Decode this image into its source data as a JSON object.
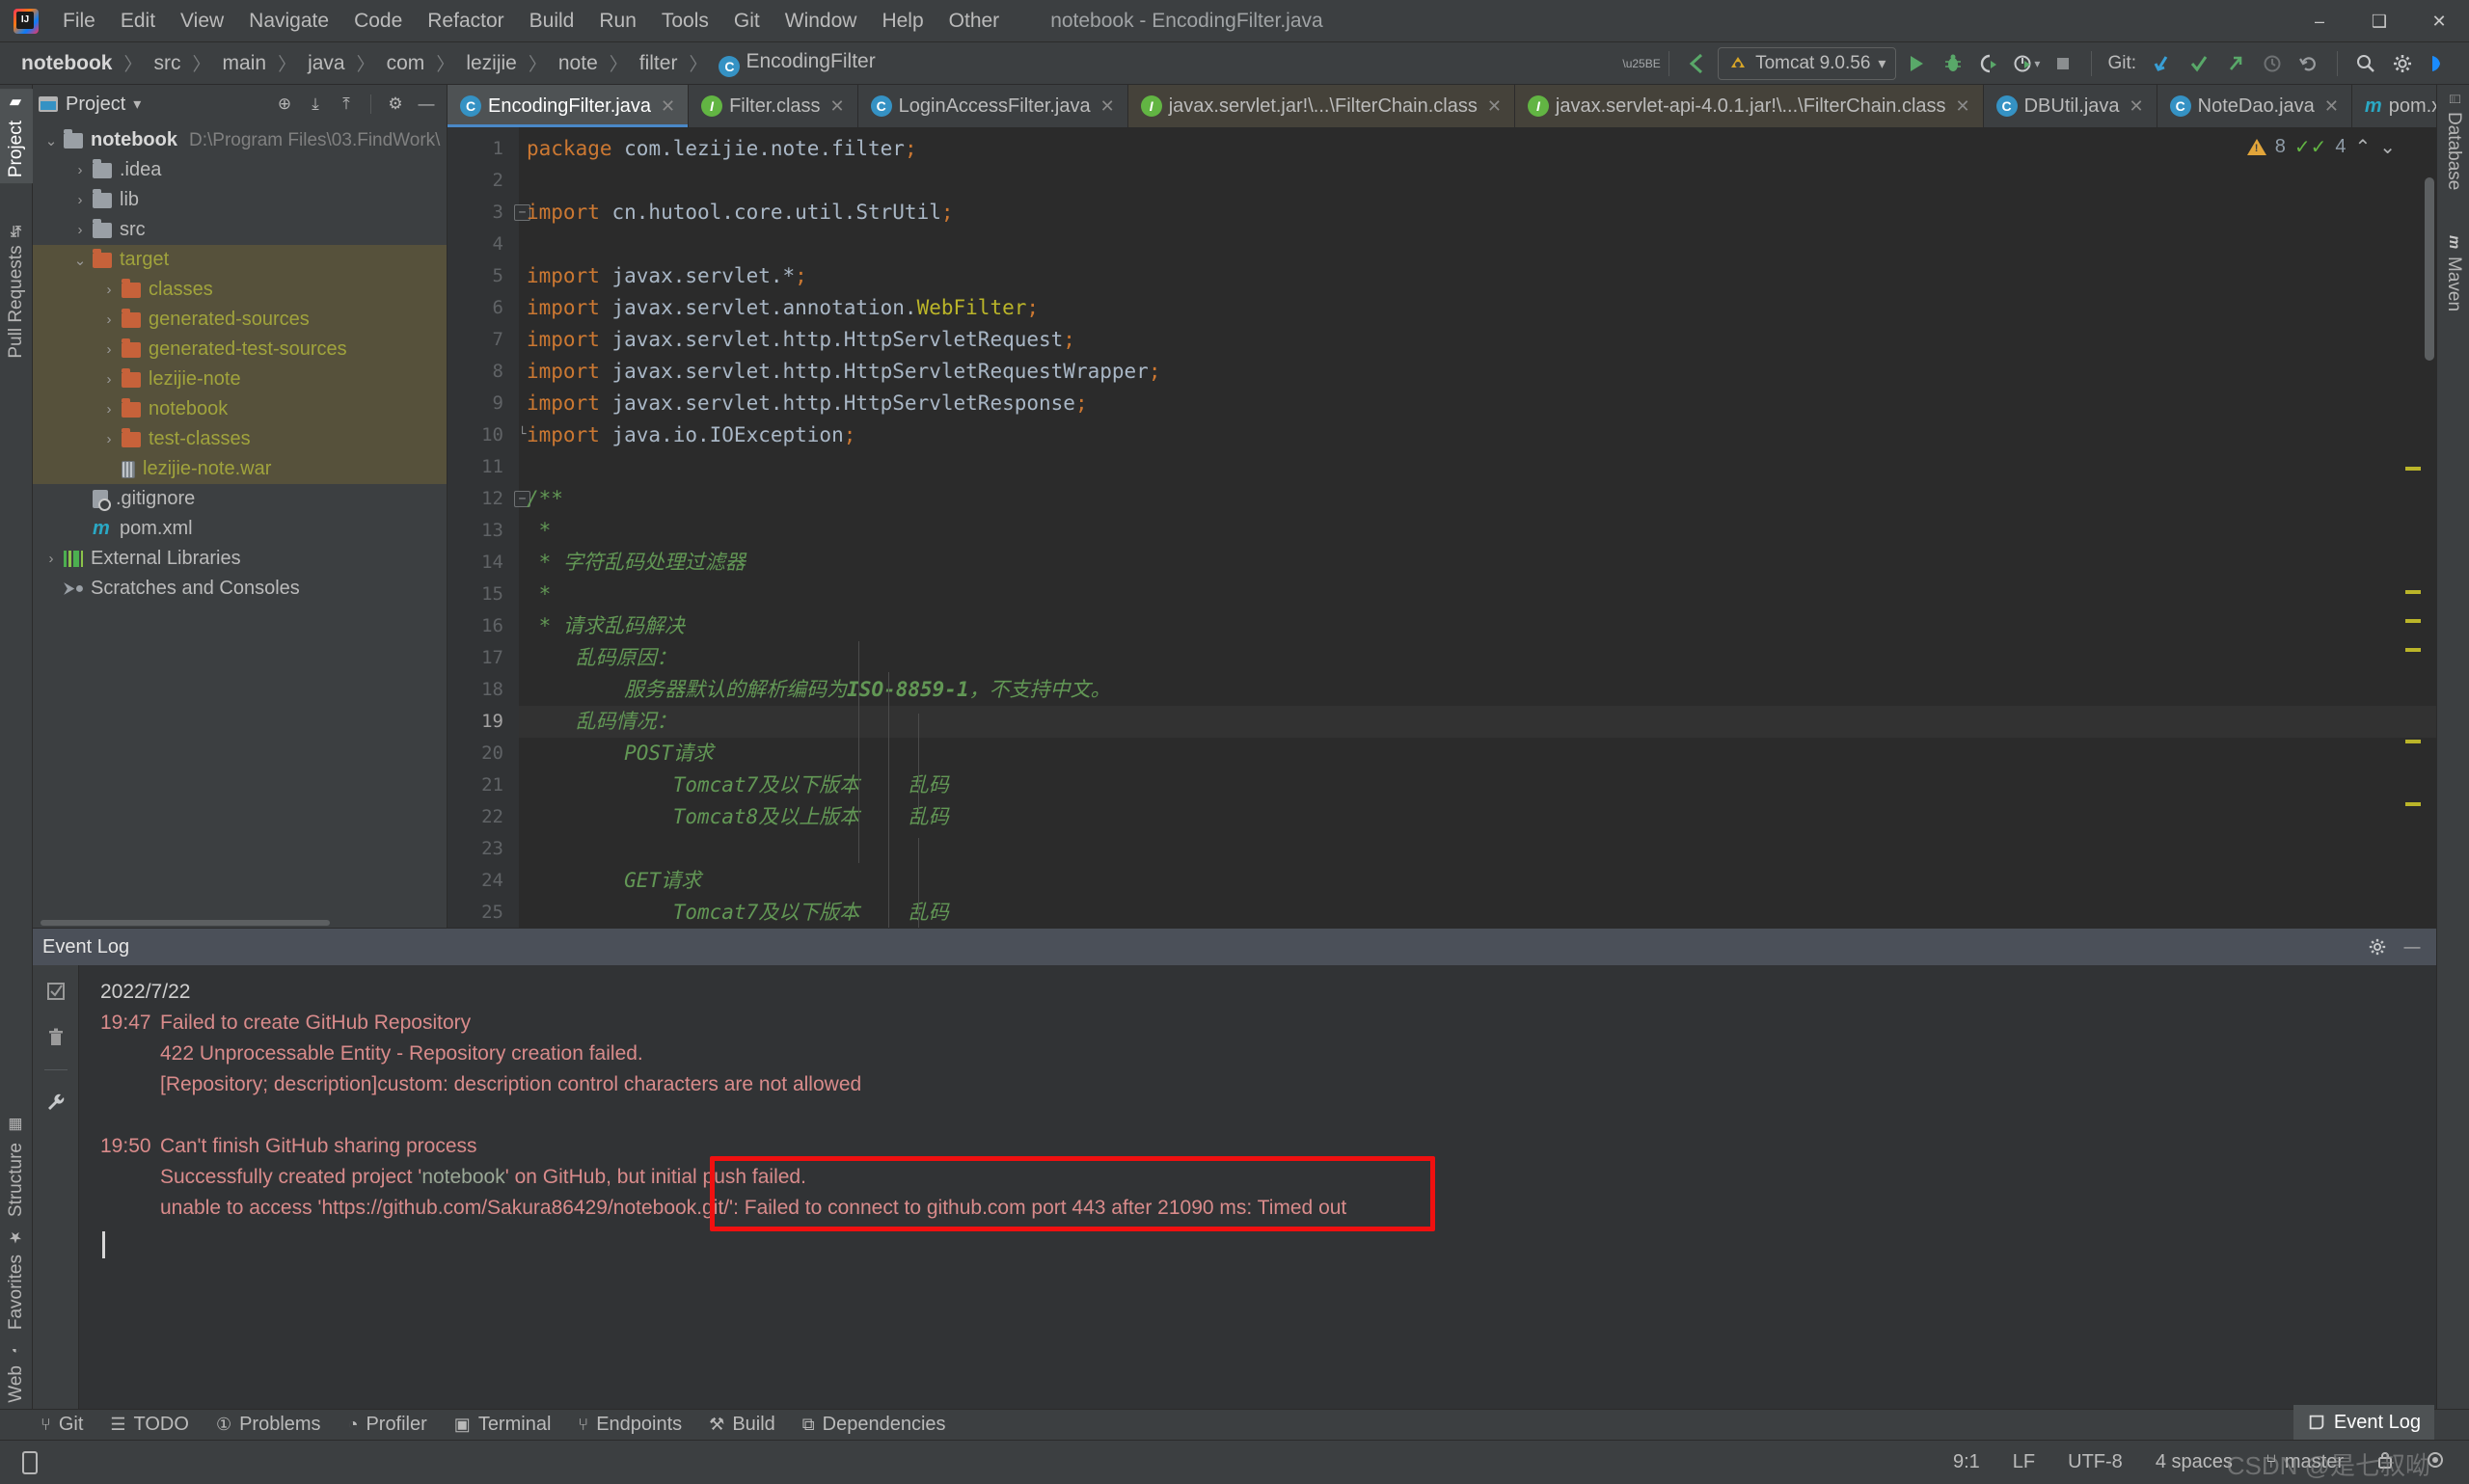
{
  "window": {
    "title": "notebook - EncodingFilter.java",
    "minimize": "–",
    "maximize": "❑",
    "close": "✕"
  },
  "menu": {
    "items": [
      {
        "label": "File"
      },
      {
        "label": "Edit"
      },
      {
        "label": "View"
      },
      {
        "label": "Navigate"
      },
      {
        "label": "Code"
      },
      {
        "label": "Refactor"
      },
      {
        "label": "Build"
      },
      {
        "label": "Run"
      },
      {
        "label": "Tools"
      },
      {
        "label": "Git"
      },
      {
        "label": "Window"
      },
      {
        "label": "Help"
      },
      {
        "label": "Other"
      }
    ]
  },
  "breadcrumb": {
    "items": [
      "notebook",
      "src",
      "main",
      "java",
      "com",
      "lezijie",
      "note",
      "filter"
    ],
    "current_class": "EncodingFilter",
    "class_icon": "C",
    "separator": "〉"
  },
  "toolbar": {
    "user_icon": "user-icon",
    "vcs_update_icon": "update-project-icon",
    "run_config": "Tomcat 9.0.56",
    "run_icon": "▶",
    "debug_icon": "debug-bug-icon",
    "coverage_icon": "run-with-coverage-icon",
    "profile_icon": "profile-icon",
    "stop_icon": "■",
    "git_label": "Git:",
    "git_update_icon": "↙",
    "git_commit_icon": "✓",
    "git_push_icon": "↗",
    "git_history_icon": "◴",
    "git_rollback_icon": "↺",
    "search_icon": "⌕",
    "settings_icon": "⚙",
    "help_icon": "ide-help-icon"
  },
  "left_strip": {
    "top": [
      {
        "label": "Project",
        "icon": "folder-icon",
        "selected": true
      },
      {
        "label": "Pull Requests",
        "icon": "pull-request-icon",
        "selected": false
      }
    ],
    "bottom": [
      {
        "label": "Structure",
        "icon": "structure-icon"
      },
      {
        "label": "Favorites",
        "icon": "star-icon"
      },
      {
        "label": "Web",
        "icon": "globe-icon"
      }
    ]
  },
  "right_strip": {
    "items": [
      {
        "label": "Database",
        "icon": "database-icon"
      },
      {
        "label": "Maven",
        "icon": "maven-m-icon"
      }
    ]
  },
  "project_panel": {
    "title": "Project",
    "dropdown_icon": "▾",
    "actions": [
      {
        "name": "select-opened-file-icon",
        "glyph": "⊕"
      },
      {
        "name": "expand-all-icon",
        "glyph": "⤓"
      },
      {
        "name": "collapse-all-icon",
        "glyph": "⤒"
      },
      {
        "name": "settings-icon",
        "glyph": "⚙"
      },
      {
        "name": "hide-icon",
        "glyph": "—"
      }
    ],
    "tree": [
      {
        "label": "notebook",
        "path": "D:\\Program Files\\03.FindWork\\",
        "depth": 0,
        "arrow": "⌄",
        "icon": "module-folder",
        "bold": true,
        "highlight": false
      },
      {
        "label": ".idea",
        "depth": 1,
        "arrow": "›",
        "icon": "folder",
        "highlight": false
      },
      {
        "label": "lib",
        "depth": 1,
        "arrow": "›",
        "icon": "folder",
        "highlight": false
      },
      {
        "label": "src",
        "depth": 1,
        "arrow": "›",
        "icon": "folder",
        "highlight": false
      },
      {
        "label": "target",
        "depth": 1,
        "arrow": "⌄",
        "icon": "folder-orange",
        "olive": true,
        "highlight": true
      },
      {
        "label": "classes",
        "depth": 2,
        "arrow": "›",
        "icon": "folder-orange",
        "olive": true,
        "highlight": true
      },
      {
        "label": "generated-sources",
        "depth": 2,
        "arrow": "›",
        "icon": "folder-orange",
        "olive": true,
        "highlight": true
      },
      {
        "label": "generated-test-sources",
        "depth": 2,
        "arrow": "›",
        "icon": "folder-orange",
        "olive": true,
        "highlight": true
      },
      {
        "label": "lezijie-note",
        "depth": 2,
        "arrow": "›",
        "icon": "folder-orange",
        "olive": true,
        "highlight": true
      },
      {
        "label": "notebook",
        "depth": 2,
        "arrow": "›",
        "icon": "folder-orange",
        "olive": true,
        "highlight": true
      },
      {
        "label": "test-classes",
        "depth": 2,
        "arrow": "›",
        "icon": "folder-orange",
        "olive": true,
        "highlight": true
      },
      {
        "label": "lezijie-note.war",
        "depth": 2,
        "arrow": "",
        "icon": "war",
        "olive": true,
        "highlight": true
      },
      {
        "label": ".gitignore",
        "depth": 1,
        "arrow": "",
        "icon": "gitignore",
        "highlight": false
      },
      {
        "label": "pom.xml",
        "depth": 1,
        "arrow": "",
        "icon": "maven",
        "highlight": false
      },
      {
        "label": "External Libraries",
        "depth": 0,
        "arrow": "›",
        "icon": "libraries",
        "highlight": false
      },
      {
        "label": "Scratches and Consoles",
        "depth": 0,
        "arrow": "",
        "icon": "scratches",
        "highlight": false
      }
    ]
  },
  "editor": {
    "tabs": [
      {
        "label": "EncodingFilter.java",
        "icon": "C",
        "kind": "class",
        "active": true,
        "close": "✕"
      },
      {
        "label": "Filter.class",
        "icon": "I",
        "kind": "interface",
        "active": false,
        "close": "✕"
      },
      {
        "label": "LoginAccessFilter.java",
        "icon": "C",
        "kind": "class",
        "active": false,
        "close": "✕"
      },
      {
        "label": "javax.servlet.jar!\\...\\FilterChain.class",
        "icon": "I",
        "kind": "interface-jar",
        "active": false,
        "close": "✕"
      },
      {
        "label": "javax.servlet-api-4.0.1.jar!\\...\\FilterChain.class",
        "icon": "I",
        "kind": "interface-jar",
        "active": false,
        "close": "✕"
      },
      {
        "label": "DBUtil.java",
        "icon": "C",
        "kind": "class",
        "active": false,
        "close": "✕"
      },
      {
        "label": "NoteDao.java",
        "icon": "C",
        "kind": "class",
        "active": false,
        "close": "✕"
      },
      {
        "label": "pom.xml (not",
        "icon": "m",
        "kind": "maven",
        "active": false,
        "close": "⌄"
      }
    ],
    "inspection": {
      "warning_count": "8",
      "ok_count": "4",
      "prev_icon": "⌃",
      "next_icon": "⌄"
    },
    "lines": [
      {
        "n": 1,
        "fold": "",
        "html": "<span class='kw'>package</span> com.lezijie.note.filter<span class='kw'>;</span>"
      },
      {
        "n": 2,
        "fold": "",
        "html": ""
      },
      {
        "n": 3,
        "fold": "minus",
        "html": "<span class='kw'>import</span> cn.hutool.core.util.StrUtil<span class='kw'>;</span>"
      },
      {
        "n": 4,
        "fold": "",
        "html": ""
      },
      {
        "n": 5,
        "fold": "",
        "html": "<span class='kw'>import</span> javax.servlet.*<span class='kw'>;</span>"
      },
      {
        "n": 6,
        "fold": "",
        "html": "<span class='kw'>import</span> javax.servlet.annotation.<span class='ann'>WebFilter</span><span class='kw'>;</span>"
      },
      {
        "n": 7,
        "fold": "",
        "html": "<span class='kw'>import</span> javax.servlet.http.HttpServletRequest<span class='kw'>;</span>"
      },
      {
        "n": 8,
        "fold": "",
        "html": "<span class='kw'>import</span> javax.servlet.http.HttpServletRequestWrapper<span class='kw'>;</span>"
      },
      {
        "n": 9,
        "fold": "",
        "html": "<span class='kw'>import</span> javax.servlet.http.HttpServletResponse<span class='kw'>;</span>"
      },
      {
        "n": 10,
        "fold": "minus-end",
        "html": "<span class='kw'>import</span> java.io.IOException<span class='kw'>;</span>"
      },
      {
        "n": 11,
        "fold": "",
        "html": ""
      },
      {
        "n": 12,
        "fold": "minus",
        "html": "<span class='cmt'>/**</span>"
      },
      {
        "n": 13,
        "fold": "",
        "html": "<span class='cmt'> *</span>"
      },
      {
        "n": 14,
        "fold": "",
        "html": "<span class='cmt'> * 字符乱码处理过滤器</span>"
      },
      {
        "n": 15,
        "fold": "",
        "html": "<span class='cmt'> *</span>"
      },
      {
        "n": 16,
        "fold": "",
        "html": "<span class='cmt'> * 请求乱码解决</span>"
      },
      {
        "n": 17,
        "fold": "",
        "html": "<span class='cmt'>    乱码原因：</span>"
      },
      {
        "n": 18,
        "fold": "",
        "html": "<span class='cmt'>        服务器默认的解析编码为</span><span class='cmtb'>ISO-8859-1</span><span class='cmt'>，不支持中文。</span>"
      },
      {
        "n": 19,
        "fold": "",
        "cur": true,
        "html": "<span class='cmt'>    乱码情况：</span>"
      },
      {
        "n": 20,
        "fold": "",
        "html": "<span class='cmt'>        POST请求</span>"
      },
      {
        "n": 21,
        "fold": "",
        "html": "<span class='cmt'>            Tomcat7及以下版本    乱码</span>"
      },
      {
        "n": 22,
        "fold": "",
        "html": "<span class='cmt'>            Tomcat8及以上版本    乱码</span>"
      },
      {
        "n": 23,
        "fold": "",
        "html": ""
      },
      {
        "n": 24,
        "fold": "",
        "html": "<span class='cmt'>        GET请求</span>"
      },
      {
        "n": 25,
        "fold": "",
        "html": "<span class='cmt'>            Tomcat7及以下版本    乱码</span>"
      }
    ]
  },
  "event_log": {
    "title": "Event Log",
    "settings_icon": "⚙",
    "hide_icon": "—",
    "side_actions": [
      {
        "name": "mark-all-read-icon",
        "glyph": "☑"
      },
      {
        "name": "clear-all-icon",
        "glyph": "🗑"
      },
      {
        "name": "settings-wrench-icon",
        "glyph": "🔧"
      }
    ],
    "date": "2022/7/22",
    "entries": [
      {
        "time": "19:47",
        "title": "Failed to create GitHub Repository",
        "details": [
          {
            "text": "422 Unprocessable Entity - Repository creation failed."
          },
          {
            "text": "[Repository; description]custom: description control characters are not allowed"
          }
        ]
      },
      {
        "time": "19:50",
        "title": "Can't finish GitHub sharing process",
        "details": [
          {
            "pre": "Successfully created project '",
            "link": "notebook",
            "post": "' on GitHub, but initial push failed."
          },
          {
            "text": "unable to access 'https://github.com/Sakura86429/notebook.git/': Failed to connect to github.com port 443 after 21090 ms: Timed out"
          }
        ]
      }
    ],
    "highlight_box_color": "#f01010"
  },
  "bottom_toolbar": {
    "items": [
      {
        "label": "Git",
        "icon": "branch-icon"
      },
      {
        "label": "TODO",
        "icon": "list-icon"
      },
      {
        "label": "Problems",
        "icon": "error-icon"
      },
      {
        "label": "Profiler",
        "icon": "profiler-icon"
      },
      {
        "label": "Terminal",
        "icon": "terminal-icon"
      },
      {
        "label": "Endpoints",
        "icon": "endpoints-icon"
      },
      {
        "label": "Build",
        "icon": "hammer-icon"
      },
      {
        "label": "Dependencies",
        "icon": "dependencies-icon"
      }
    ]
  },
  "status_bar": {
    "left_icon": "mobile-preview-icon",
    "event_log_popup": "Event Log",
    "event_log_icon": "event-log-icon",
    "caret_position": "9:1",
    "line_separator": "LF",
    "encoding": "UTF-8",
    "indent": "4 spaces",
    "branch": "master",
    "branch_icon": "⑂",
    "lock_icon": "🔒",
    "inspection_icon": "◉"
  },
  "watermark": "CSDN @是七叔呦"
}
